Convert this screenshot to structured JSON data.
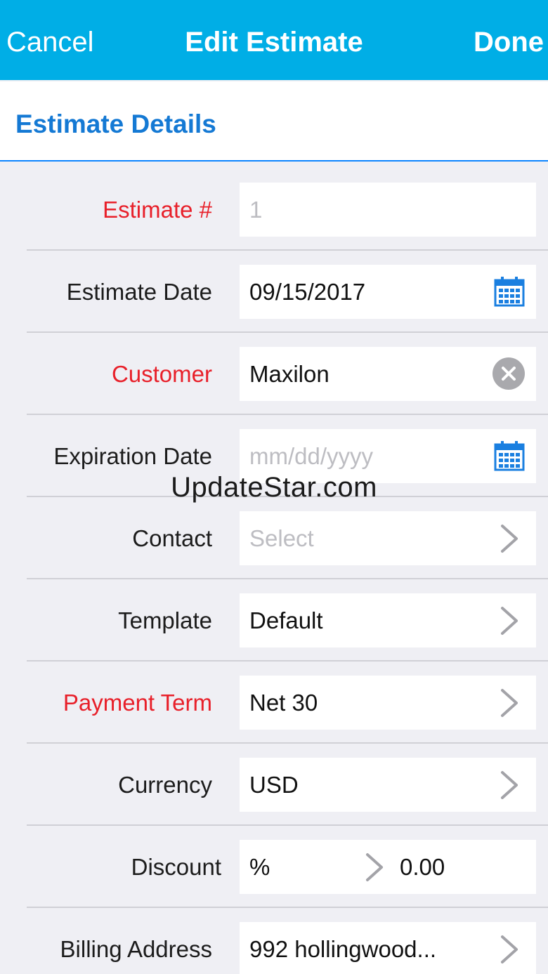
{
  "nav": {
    "cancel": "Cancel",
    "title": "Edit Estimate",
    "done": "Done",
    "background": "#00aee6"
  },
  "section": {
    "title": "Estimate Details"
  },
  "form": {
    "estimate_number": {
      "label": "Estimate #",
      "value": "1"
    },
    "estimate_date": {
      "label": "Estimate Date",
      "value": "09/15/2017",
      "icon": "calendar-icon"
    },
    "customer": {
      "label": "Customer",
      "value": "Maxilon",
      "icon": "clear-icon"
    },
    "expiration_date": {
      "label": "Expiration Date",
      "placeholder": "mm/dd/yyyy",
      "icon": "calendar-icon"
    },
    "contact": {
      "label": "Contact",
      "placeholder": "Select",
      "icon": "chevron-right-icon"
    },
    "template": {
      "label": "Template",
      "value": "Default",
      "icon": "chevron-right-icon"
    },
    "payment_term": {
      "label": "Payment Term",
      "value": "Net 30",
      "icon": "chevron-right-icon"
    },
    "currency": {
      "label": "Currency",
      "value": "USD",
      "icon": "chevron-right-icon"
    },
    "discount": {
      "label": "Discount",
      "type": "%",
      "value": "0.00",
      "icon": "chevron-right-icon"
    },
    "billing_address": {
      "label": "Billing Address",
      "value": "992 hollingwood...",
      "icon": "chevron-right-icon"
    }
  },
  "colors": {
    "required_label": "#e8202a",
    "accent": "#1479d4",
    "icon_blue": "#1a7fe0"
  },
  "watermark": "UpdateStar.com"
}
